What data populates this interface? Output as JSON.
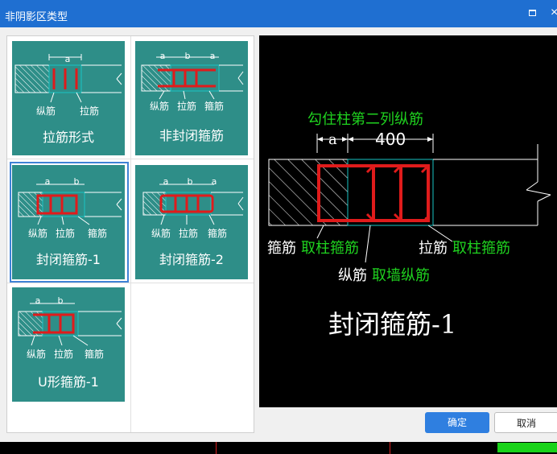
{
  "window": {
    "title": "非阴影区类型",
    "maximize_icon": "maximize-icon",
    "close_icon": "close-icon",
    "close_glyph": "×"
  },
  "gallery": {
    "options": [
      {
        "name": "拉筋形式",
        "labels": [
          "纵筋",
          "拉筋"
        ],
        "dims": [
          "a"
        ]
      },
      {
        "name": "非封闭箍筋",
        "labels": [
          "纵筋",
          "拉筋",
          "箍筋"
        ],
        "dims": [
          "a",
          "b",
          "a"
        ]
      },
      {
        "name": "封闭箍筋-1",
        "labels": [
          "纵筋",
          "拉筋",
          "箍筋"
        ],
        "dims": [
          "a",
          "b"
        ],
        "selected": true
      },
      {
        "name": "封闭箍筋-2",
        "labels": [
          "纵筋",
          "拉筋",
          "箍筋"
        ],
        "dims": [
          "a",
          "b",
          "a"
        ]
      },
      {
        "name": "U形箍筋-1",
        "labels": [
          "纵筋",
          "拉筋",
          "箍筋"
        ],
        "dims": [
          "a",
          "b"
        ]
      }
    ]
  },
  "preview": {
    "top_note": "勾住柱第二列纵筋",
    "dim_a": "a",
    "dim_value": "400",
    "stirrup_label": "箍筋",
    "stirrup_value": "取柱箍筋",
    "tie_label": "拉筋",
    "tie_value": "取柱箍筋",
    "long_label": "纵筋",
    "long_value": "取墙纵筋",
    "title": "封闭箍筋-1"
  },
  "buttons": {
    "ok": "确定",
    "cancel": "取消"
  },
  "colors": {
    "titlebar": "#1f6fd1",
    "tile": "#2e8e88",
    "rebar": "#e01b1b",
    "cyan": "#19c4c4",
    "green_text": "#1fd21f",
    "selection": "#3f82d6",
    "primary": "#2f7fe0"
  }
}
